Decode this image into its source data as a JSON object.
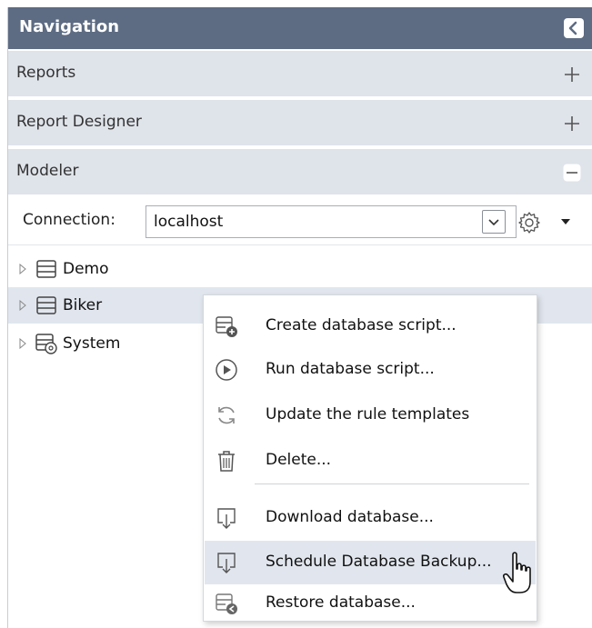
{
  "navigation": {
    "title": "Navigation",
    "collapse_icon": "chevron-left-icon"
  },
  "sections": [
    {
      "label": "Reports",
      "state": "collapsed",
      "toggle_icon": "plus-icon"
    },
    {
      "label": "Report Designer",
      "state": "collapsed",
      "toggle_icon": "plus-icon"
    },
    {
      "label": "Modeler",
      "state": "expanded",
      "toggle_icon": "minus-icon"
    }
  ],
  "connection": {
    "label": "Connection:",
    "value": "localhost",
    "settings_icon": "gear-icon"
  },
  "tree": [
    {
      "label": "Demo",
      "icon": "database-icon",
      "selected": false
    },
    {
      "label": "Biker",
      "icon": "database-icon",
      "selected": true
    },
    {
      "label": "System",
      "icon": "system-database-icon",
      "selected": false
    }
  ],
  "context_menu": {
    "items": [
      {
        "label": "Create database script...",
        "icon": "create-script-icon"
      },
      {
        "label": "Run database script...",
        "icon": "play-circle-icon"
      },
      {
        "label": "Update the rule templates",
        "icon": "refresh-icon"
      },
      {
        "label": "Delete...",
        "icon": "trash-icon"
      },
      {
        "label": "Download database...",
        "icon": "download-icon"
      },
      {
        "label": "Schedule Database Backup...",
        "icon": "download-icon",
        "hovered": true
      },
      {
        "label": "Restore database...",
        "icon": "restore-icon"
      }
    ]
  },
  "colors": {
    "header_bg": "#5d6c83",
    "section_bg": "#dfe3ea",
    "selection_bg": "#e1e6ee"
  }
}
